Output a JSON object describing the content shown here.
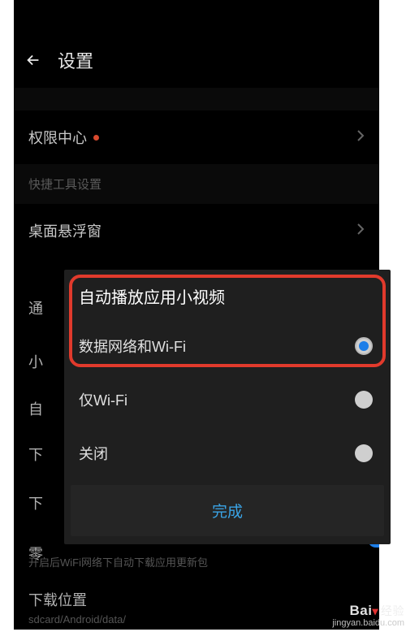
{
  "header": {
    "title": "设置"
  },
  "settings": {
    "permission_center": "权限中心",
    "quick_tools_section": "快捷工具设置",
    "desktop_float": "桌面悬浮窗",
    "partial_tong": "通",
    "partial_xiao": "小",
    "partial_zi": "自",
    "partial_xia": "下",
    "partial_xia2": "下",
    "partial_ling": "零",
    "auto_update_desc": "开启后WiFi网络下自动下载应用更新包",
    "download_location": "下载位置",
    "download_path": "sdcard/Android/data/"
  },
  "dialog": {
    "title": "自动播放应用小视频",
    "options": [
      {
        "label": "数据网络和Wi-Fi",
        "selected": true
      },
      {
        "label": "仅Wi-Fi",
        "selected": false
      },
      {
        "label": "关闭",
        "selected": false
      }
    ],
    "done": "完成"
  },
  "watermark": {
    "brand": "Bai",
    "brand_suffix": "经验",
    "url": "jingyan.baidu.com"
  }
}
